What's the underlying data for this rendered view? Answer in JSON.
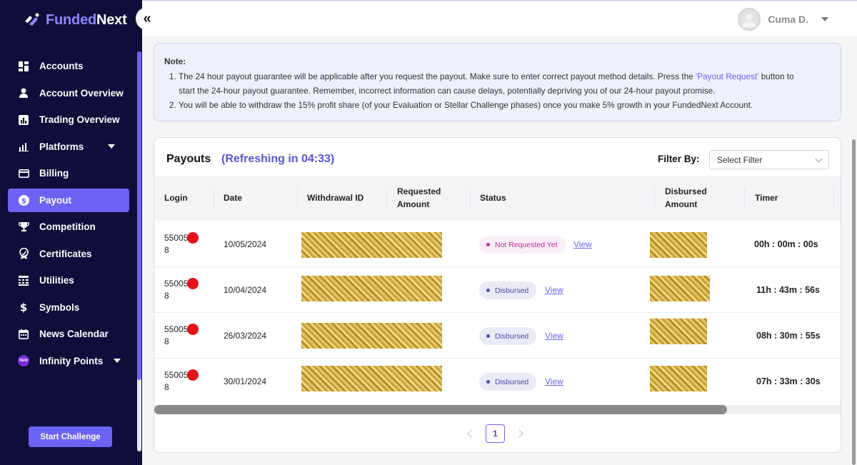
{
  "brand": {
    "part_a": "Funded",
    "part_b": "Next"
  },
  "collapse": {
    "glyph": "«"
  },
  "sidebar": {
    "items": [
      {
        "label": "Accounts",
        "icon": "grid-icon"
      },
      {
        "label": "Account Overview",
        "icon": "user-icon"
      },
      {
        "label": "Trading Overview",
        "icon": "chart-icon"
      },
      {
        "label": "Platforms",
        "icon": "platform-icon"
      },
      {
        "label": "Billing",
        "icon": "card-icon"
      },
      {
        "label": "Payout",
        "icon": "dollar-circle-icon"
      },
      {
        "label": "Competition",
        "icon": "trophy-icon"
      },
      {
        "label": "Certificates",
        "icon": "certificate-icon"
      },
      {
        "label": "Utilities",
        "icon": "calculator-icon"
      },
      {
        "label": "Symbols",
        "icon": "dollar-icon"
      },
      {
        "label": "News Calendar",
        "icon": "calendar-icon"
      },
      {
        "label": "Infinity Points",
        "icon": "new-badge-icon",
        "badge": "NEW"
      }
    ],
    "start_button": "Start Challenge"
  },
  "topbar": {
    "user_name": "Cuma D."
  },
  "note": {
    "title": "Note:",
    "item1_part1": "The 24 hour payout guarantee will be applicable after you request the payout. Make sure to enter correct payout method details. Press the ",
    "item1_link": "'Payout Request'",
    "item1_part2": " button to",
    "item1_line2": "start the 24-hour payout guarantee. Remember, incorrect information can cause delays, potentially depriving you of our 24-hour payout promise.",
    "item2": "You will be able to withdraw the 15% profit share (of your Evaluation or Stellar Challenge phases) once you make 5% growth in your FundedNext Account."
  },
  "payouts": {
    "title": "Payouts",
    "refresh": "(Refreshing in 04:33)",
    "filter_label": "Filter By:",
    "filter_placeholder": "Select Filter",
    "columns": {
      "login": "Login",
      "date": "Date",
      "withdrawal_id": "Withdrawal ID",
      "requested_1": "Requested",
      "requested_2": "Amount",
      "status": "Status",
      "disbursed_1": "Disbursed",
      "disbursed_2": "Amount",
      "timer": "Timer"
    },
    "rows": [
      {
        "login_1": "55005",
        "login_2": "8",
        "date": "10/05/2024",
        "status": "Not Requested Yet",
        "view": "View",
        "timer": "00h : 00m : 00s"
      },
      {
        "login_1": "55005",
        "login_2": "8",
        "date": "10/04/2024",
        "status": "Disbursed",
        "view": "View",
        "timer": "11h : 43m : 56s"
      },
      {
        "login_1": "55005",
        "login_2": "8",
        "date": "26/03/2024",
        "status": "Disbursed",
        "view": "View",
        "timer": "08h : 30m : 55s"
      },
      {
        "login_1": "55005",
        "login_2": "8",
        "date": "30/01/2024",
        "status": "Disbursed",
        "view": "View",
        "timer": "07h : 33m : 30s"
      }
    ],
    "page": "1"
  },
  "colors": {
    "sidebar_bg": "#0f0e3a",
    "accent": "#6c63f5",
    "not_requested": "#c42a93",
    "disbursed": "#4a47a8"
  }
}
